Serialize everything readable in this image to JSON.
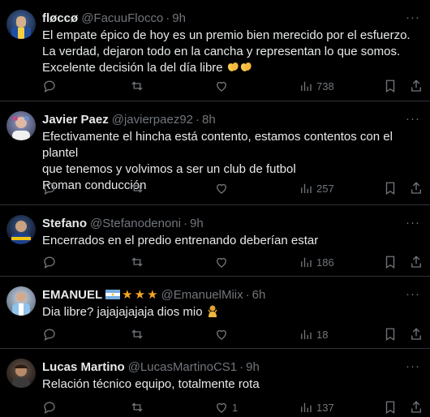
{
  "tweets": [
    {
      "name": "fløccø",
      "handle": "@FacuuFlocco",
      "time": "9h",
      "lines": [
        "El empate épico de hoy es un premio bien merecido por el esfuerzo.",
        "La verdad, dejaron todo en la cancha y representan lo que somos.",
        "Excelente decisión la del día libre"
      ],
      "emoji": "clapping-hands",
      "replies": "",
      "retweets": "",
      "likes": "",
      "views": "738"
    },
    {
      "name": "Javier Paez",
      "handle": "@javierpaez92",
      "time": "8h",
      "lines": [
        "Efectivamente el hincha está contento, estamos contentos con el plantel",
        "que tenemos y volvimos a ser un club de futbol",
        "Roman conducción"
      ],
      "replies": "",
      "retweets": "",
      "likes": "",
      "views": "257"
    },
    {
      "name": "Stefano",
      "handle": "@Stefanodenoni",
      "time": "9h",
      "lines": [
        "Encerrados en el predio entrenando deberían estar"
      ],
      "replies": "",
      "retweets": "",
      "likes": "",
      "views": "186"
    },
    {
      "name": "EMANUEL",
      "name_decor": "argentina-flag star star star",
      "handle": "@EmanuelMiix",
      "time": "6h",
      "lines": [
        "Dia libre? jajajajajaja dios mio"
      ],
      "emoji": "person-gesturing",
      "replies": "",
      "retweets": "",
      "likes": "",
      "views": "18"
    },
    {
      "name": "Lucas Martino",
      "handle": "@LucasMartinoCS1",
      "time": "9h",
      "lines": [
        "Relación técnico equipo, totalmente rota"
      ],
      "replies": "",
      "retweets": "",
      "likes": "1",
      "views": "137"
    }
  ],
  "more_label": "···",
  "dot": "·",
  "colors": {
    "background": "#000000",
    "text": "#e7e9ea",
    "muted": "#71767b",
    "divider": "#2f3336",
    "star": "#f5a623"
  }
}
